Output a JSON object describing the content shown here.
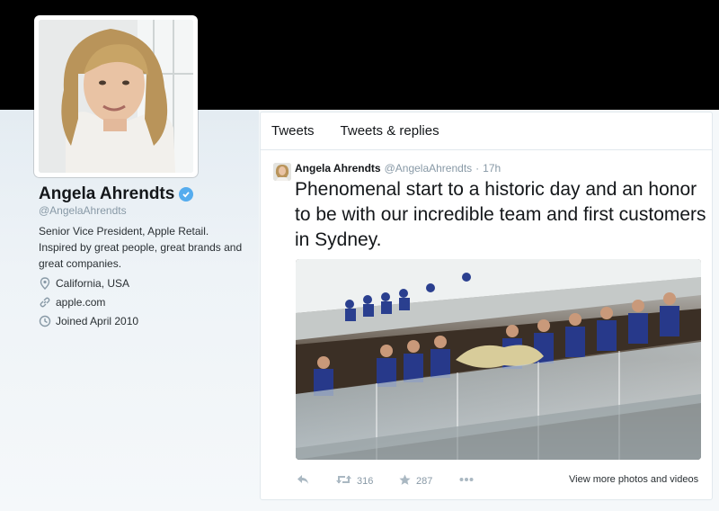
{
  "profile": {
    "name": "Angela Ahrendts",
    "handle": "@AngelaAhrendts",
    "verified_icon": "verified-badge-icon",
    "bio": "Senior Vice President, Apple Retail. Inspired by great people, great brands and great companies.",
    "location": "California, USA",
    "website": "apple.com",
    "joined": "Joined April 2010",
    "location_icon": "location-pin-icon",
    "link_icon": "link-icon",
    "joined_icon": "calendar-icon"
  },
  "tabs": [
    {
      "label": "Tweets"
    },
    {
      "label": "Tweets & replies"
    }
  ],
  "tweet": {
    "name": "Angela Ahrendts",
    "handle": "@AngelaAhrendts",
    "dot": "·",
    "time": "17h",
    "text": "Phenomenal start to a historic day and an honor to be with our incredible team and first customers in Sydney.",
    "actions": {
      "reply_icon": "reply-icon",
      "retweet_icon": "retweet-icon",
      "retweet_count": "316",
      "favorite_icon": "star-icon",
      "favorite_count": "287",
      "more_icon": "more-dots-icon",
      "view_more": "View more photos and videos"
    }
  },
  "colors": {
    "banner": "#000000",
    "accent": "#55acee",
    "muted": "#8899a6",
    "text": "#14171a"
  }
}
